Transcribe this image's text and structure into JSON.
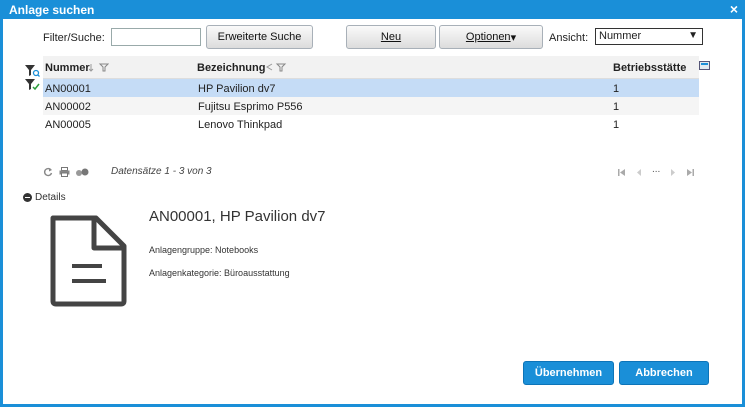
{
  "window": {
    "title": "Anlage suchen",
    "close_glyph": "×"
  },
  "toolbar": {
    "filter_label": "Filter/Suche:",
    "filter_value": "",
    "advanced_search": "Erweiterte Suche",
    "new": "Neu",
    "options": "Optionen",
    "options_arrow": "▾",
    "view_label": "Ansicht:",
    "view_selected": "Nummer",
    "view_arrow": "▼"
  },
  "grid": {
    "columns": [
      "Nummer",
      "Bezeichnung",
      "Betriebsstätte"
    ],
    "rows": [
      {
        "nummer": "AN00001",
        "bezeichnung": "HP Pavilion dv7",
        "betriebsstaette": "1",
        "selected": true
      },
      {
        "nummer": "AN00002",
        "bezeichnung": "Fujitsu Esprimo P556",
        "betriebsstaette": "1",
        "selected": false
      },
      {
        "nummer": "AN00005",
        "bezeichnung": "Lenovo Thinkpad",
        "betriebsstaette": "1",
        "selected": false
      }
    ]
  },
  "pager": {
    "info": "Datensätze 1 - 3 von 3",
    "ellipsis": "..."
  },
  "details": {
    "toggle_label": "Details",
    "title": "AN00001, HP Pavilion dv7",
    "group": "Anlagengruppe: Notebooks",
    "category": "Anlagenkategorie: Büroausstattung"
  },
  "actions": {
    "accept": "Übernehmen",
    "cancel": "Abbrechen"
  },
  "colors": {
    "accent": "#1a8fd8",
    "selected_row": "#c5dcf6"
  }
}
